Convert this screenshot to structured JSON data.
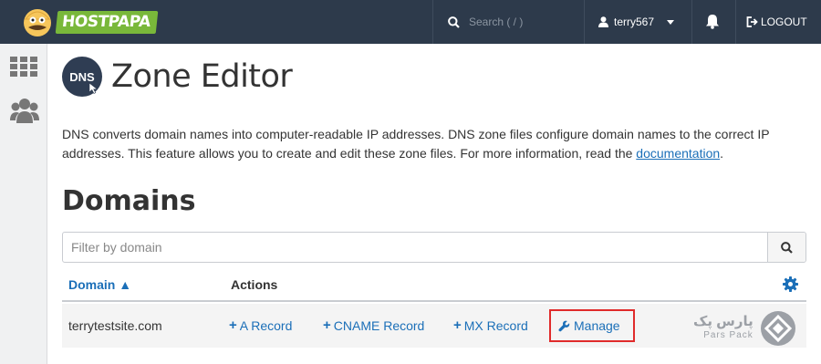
{
  "brand": {
    "name": "HOSTPAPA",
    "accent": "#79b83a",
    "topbar_color": "#2d3a4b"
  },
  "topbar": {
    "search_placeholder": "Search ( / )",
    "username": "terry567",
    "logout_label": "LOGOUT"
  },
  "sidebar": {
    "items": [
      {
        "icon": "grid-icon"
      },
      {
        "icon": "users-icon"
      }
    ]
  },
  "page": {
    "icon_text": "DNS",
    "title": "Zone Editor",
    "description_text": "DNS converts domain names into computer-readable IP addresses. DNS zone files configure domain names to the correct IP addresses. This feature allows you to create and edit these zone files. For more information, read the ",
    "description_link": "documentation",
    "description_end": "."
  },
  "domains": {
    "section_title": "Domains",
    "filter_placeholder": "Filter by domain",
    "columns": {
      "domain": "Domain ▲",
      "actions": "Actions"
    },
    "rows": [
      {
        "domain": "terrytestsite.com",
        "actions": {
          "a_record": "A Record",
          "cname_record": "CNAME Record",
          "mx_record": "MX Record",
          "manage": "Manage"
        }
      }
    ],
    "highlight_color": "#e02b2b",
    "link_color": "#1b6fb8"
  },
  "watermark": {
    "text_fa": "پارس پک",
    "text_en": "Pars Pack"
  }
}
